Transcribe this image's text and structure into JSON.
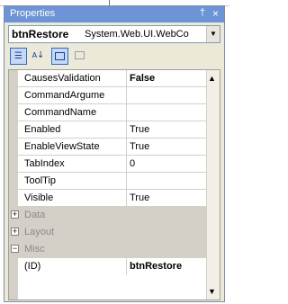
{
  "window": {
    "title": "Properties",
    "pin_glyph": "†",
    "close_glyph": "×"
  },
  "selector": {
    "object_name": "btnRestore",
    "object_type": "System.Web.UI.WebCo",
    "dropdown_glyph": "▼"
  },
  "toolbar": {
    "categorized_icon": "categorized-icon",
    "alphabetical_icon": "alphabetical-icon",
    "properties_icon": "properties-icon",
    "events_icon": "events-icon",
    "az_glyph": "↓"
  },
  "properties": [
    {
      "name": "CausesValidation",
      "value": "False",
      "bold": true
    },
    {
      "name": "CommandArgume",
      "value": ""
    },
    {
      "name": "CommandName",
      "value": ""
    },
    {
      "name": "Enabled",
      "value": "True"
    },
    {
      "name": "EnableViewState",
      "value": "True"
    },
    {
      "name": "TabIndex",
      "value": "0"
    },
    {
      "name": "ToolTip",
      "value": ""
    },
    {
      "name": "Visible",
      "value": "True"
    }
  ],
  "categories": [
    {
      "label": "Data",
      "state": "+"
    },
    {
      "label": "Layout",
      "state": "+"
    },
    {
      "label": "Misc",
      "state": "−"
    }
  ],
  "misc_property": {
    "name": "(ID)",
    "value": "btnRestore"
  },
  "scrollbar": {
    "up": "▲",
    "down": "▼"
  },
  "colors": {
    "titlebar": "#6d94d6",
    "panel": "#ece9d8",
    "gutter": "#d4d0c8",
    "category_text": "#8a8a8a"
  }
}
